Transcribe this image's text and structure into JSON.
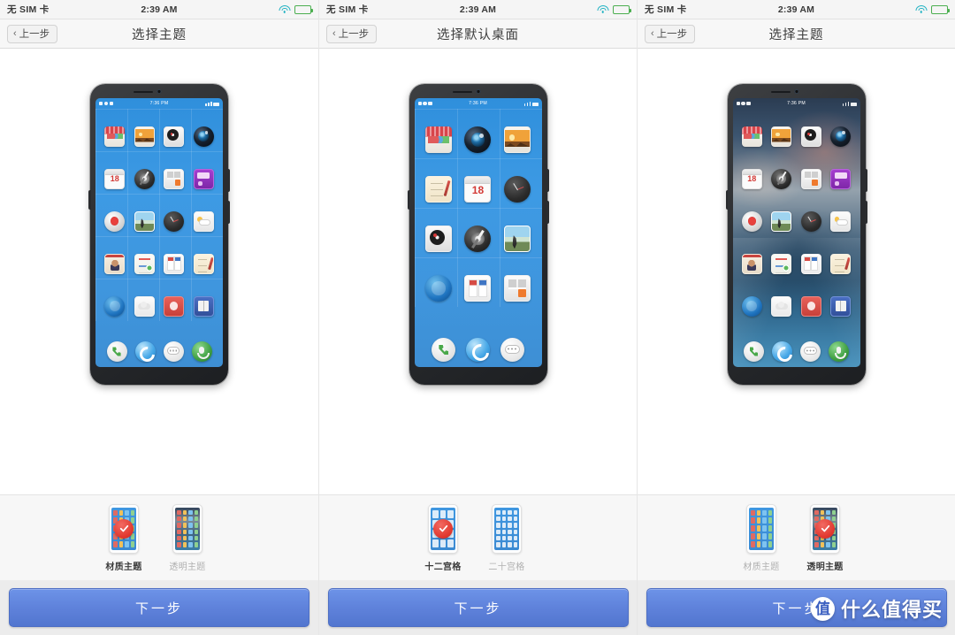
{
  "statusbar": {
    "carrier": "无 SIM 卡",
    "time": "2:39 AM",
    "wifi_icon": "wifi-icon",
    "battery_icon": "battery-icon"
  },
  "phone_status": {
    "time": "7:36 PM"
  },
  "panels": [
    {
      "id": "theme-1",
      "nav": {
        "back_label": "上一步",
        "back_chevron": "‹",
        "title": "选择主题"
      },
      "preview": {
        "wallpaper": "blue-gradient",
        "grid": "4-column",
        "icons": [
          "app-store-icon",
          "gallery-icon",
          "music-icon",
          "camera-icon",
          "calendar-icon",
          "compass-icon",
          "calculator-icon",
          "game-icon",
          "recorder-icon",
          "photos-icon",
          "clock-icon",
          "weather-icon",
          "contacts-icon",
          "notes-icon",
          "documents-icon",
          "memo-icon",
          "browser-ball-icon",
          "cloud-icon",
          "red-app-icon",
          "book-icon"
        ],
        "calendar_day": "18",
        "dock": [
          "phone-icon",
          "browser-icon",
          "messages-icon",
          "recorder-dock-icon"
        ]
      },
      "thumbnails": [
        {
          "label": "材质主题",
          "selected": true,
          "style": "blue-grid"
        },
        {
          "label": "透明主题",
          "selected": false,
          "style": "photo-grid"
        }
      ],
      "next_label": "下一步"
    },
    {
      "id": "desktop-layout",
      "nav": {
        "back_label": "上一步",
        "back_chevron": "‹",
        "title": "选择默认桌面"
      },
      "preview": {
        "wallpaper": "blue-gradient",
        "grid": "3-column",
        "icons": [
          "app-store-icon",
          "camera-icon",
          "gallery-icon",
          "memo-icon",
          "calendar-icon",
          "clock-icon",
          "music-icon",
          "compass-icon",
          "photos-icon",
          "browser-ball-icon",
          "documents-icon",
          "calculator-icon"
        ],
        "calendar_day": "18",
        "dock": [
          "phone-icon",
          "browser-icon",
          "messages-icon"
        ]
      },
      "thumbnails": [
        {
          "label": "十二宫格",
          "selected": true,
          "style": "blue-grid-12"
        },
        {
          "label": "二十宫格",
          "selected": false,
          "style": "blue-grid-20"
        }
      ],
      "next_label": "下一步"
    },
    {
      "id": "theme-2",
      "nav": {
        "back_label": "上一步",
        "back_chevron": "‹",
        "title": "选择主题"
      },
      "preview": {
        "wallpaper": "mountain-photo",
        "grid": "4-column",
        "icons": [
          "app-store-icon",
          "gallery-icon",
          "music-icon",
          "camera-icon",
          "calendar-icon",
          "compass-icon",
          "calculator-icon",
          "game-icon",
          "recorder-icon",
          "photos-icon",
          "clock-icon",
          "weather-icon",
          "contacts-icon",
          "notes-icon",
          "documents-icon",
          "memo-icon",
          "browser-ball-icon",
          "cloud-icon",
          "red-app-icon",
          "book-icon"
        ],
        "calendar_day": "18",
        "dock": [
          "phone-icon",
          "browser-icon",
          "messages-icon",
          "recorder-dock-icon"
        ]
      },
      "thumbnails": [
        {
          "label": "材质主题",
          "selected": false,
          "style": "blue-grid"
        },
        {
          "label": "透明主题",
          "selected": true,
          "style": "photo-grid"
        }
      ],
      "next_label": "下一步"
    }
  ],
  "watermark": {
    "logo_char": "值",
    "text": "什么值得买"
  },
  "colors": {
    "accent_blue": "#5f82db",
    "check_red": "#e0352c",
    "screen_blue": "#3d9ae4",
    "strip_bg": "#f7f7f7",
    "footer_bg": "#ececec"
  }
}
